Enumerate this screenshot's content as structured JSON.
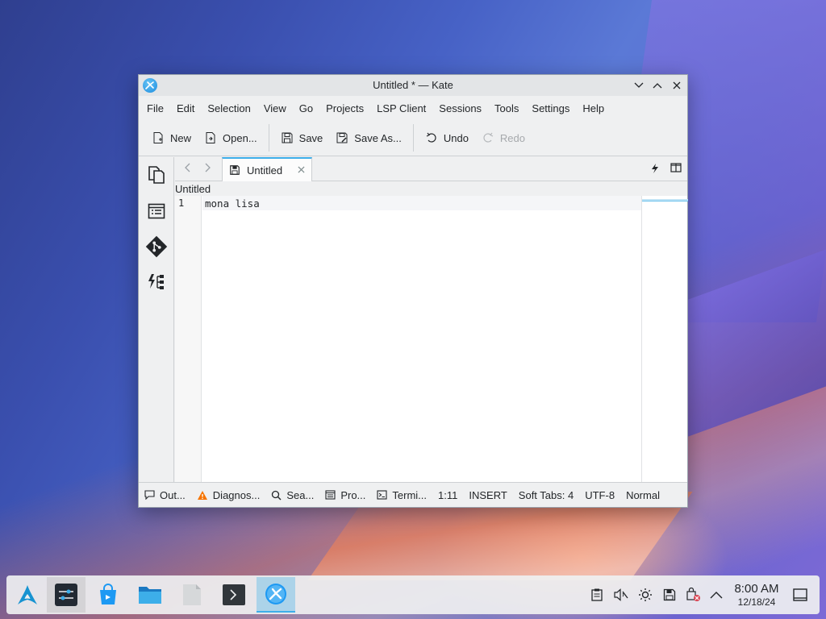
{
  "window": {
    "title": "Untitled * — Kate"
  },
  "menu": [
    "File",
    "Edit",
    "Selection",
    "View",
    "Go",
    "Projects",
    "LSP Client",
    "Sessions",
    "Tools",
    "Settings",
    "Help"
  ],
  "toolbar": {
    "new_label": "New",
    "open_label": "Open...",
    "save_label": "Save",
    "saveas_label": "Save As...",
    "undo_label": "Undo",
    "redo_label": "Redo"
  },
  "tab": {
    "label": "Untitled"
  },
  "breadcrumb": "Untitled",
  "editor": {
    "line_number": "1",
    "line_text": "mona lisa"
  },
  "statusbar": {
    "output": "Out...",
    "diagnostics": "Diagnos...",
    "search": "Sea...",
    "projects": "Pro...",
    "terminal": "Termi...",
    "cursor": "1:11",
    "mode": "INSERT",
    "indent": "Soft Tabs: 4",
    "encoding": "UTF-8",
    "syntax": "Normal"
  },
  "panel": {
    "time": "8:00 AM",
    "date": "12/18/24"
  },
  "colors": {
    "accent": "#3daee9",
    "warning": "#f67400"
  }
}
